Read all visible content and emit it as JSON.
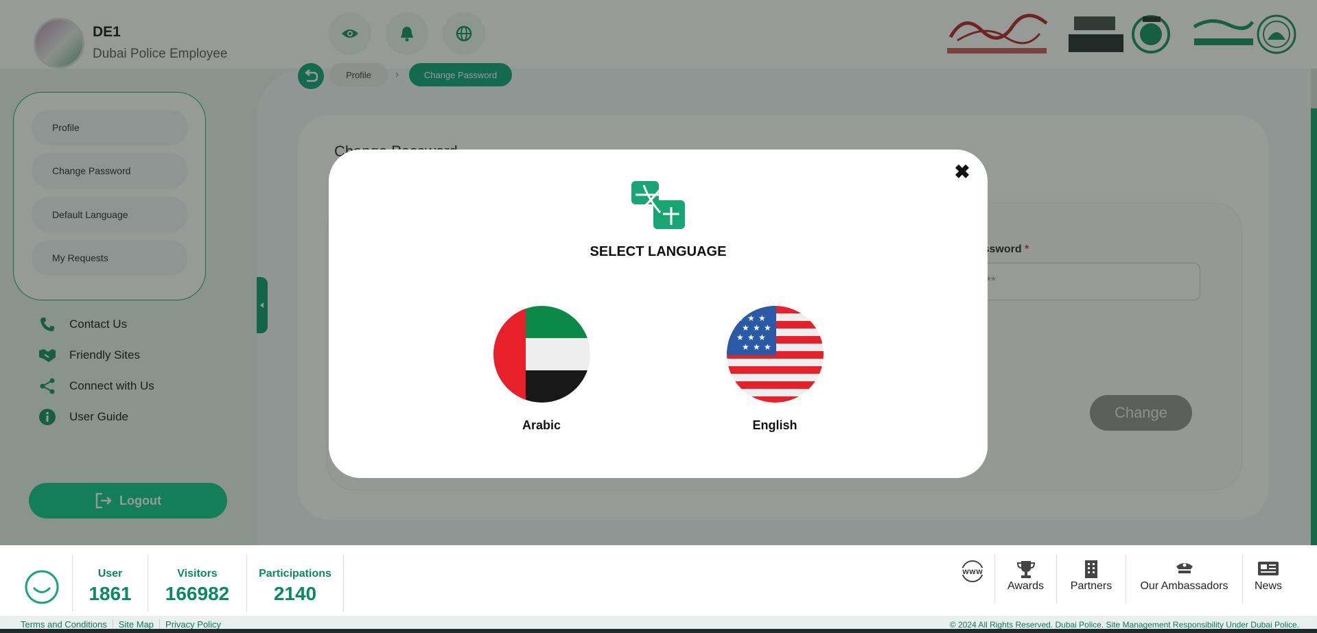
{
  "header": {
    "user_name": "DE1",
    "user_role": "Dubai Police Employee",
    "icons": [
      "eye-icon",
      "bell-icon",
      "globe-icon"
    ],
    "logos": [
      "GOVERNMENT OF DUBAI",
      "Efaad",
      "DUBAI POLICE"
    ]
  },
  "sidebar": {
    "menu": [
      "Profile",
      "Change Password",
      "Default Language",
      "My Requests"
    ],
    "links": [
      "Contact Us",
      "Friendly Sites",
      "Connect with Us",
      "User Guide"
    ],
    "logout": "Logout"
  },
  "breadcrumb": [
    "Profile",
    "Change Password"
  ],
  "main": {
    "title": "Change Password",
    "field_label": "Password",
    "field_placeholder": "**",
    "button": "Change"
  },
  "modal": {
    "title": "SELECT LANGUAGE",
    "options": [
      "Arabic",
      "English"
    ]
  },
  "footer": {
    "stats": [
      {
        "label": "User",
        "value": "1861"
      },
      {
        "label": "Visitors",
        "value": "166982"
      },
      {
        "label": "Participations",
        "value": "2140"
      }
    ],
    "links": [
      "Awards",
      "Partners",
      "Our Ambassadors",
      "News"
    ],
    "legal": [
      "Terms and Conditions",
      "Site Map",
      "Privacy Policy"
    ],
    "copyright": "© 2024 All Rights Reserved. Dubai Police. Site Management Responsibility Under Dubai Police."
  },
  "colors": {
    "primary": "#07a271",
    "accent": "#07c686"
  }
}
